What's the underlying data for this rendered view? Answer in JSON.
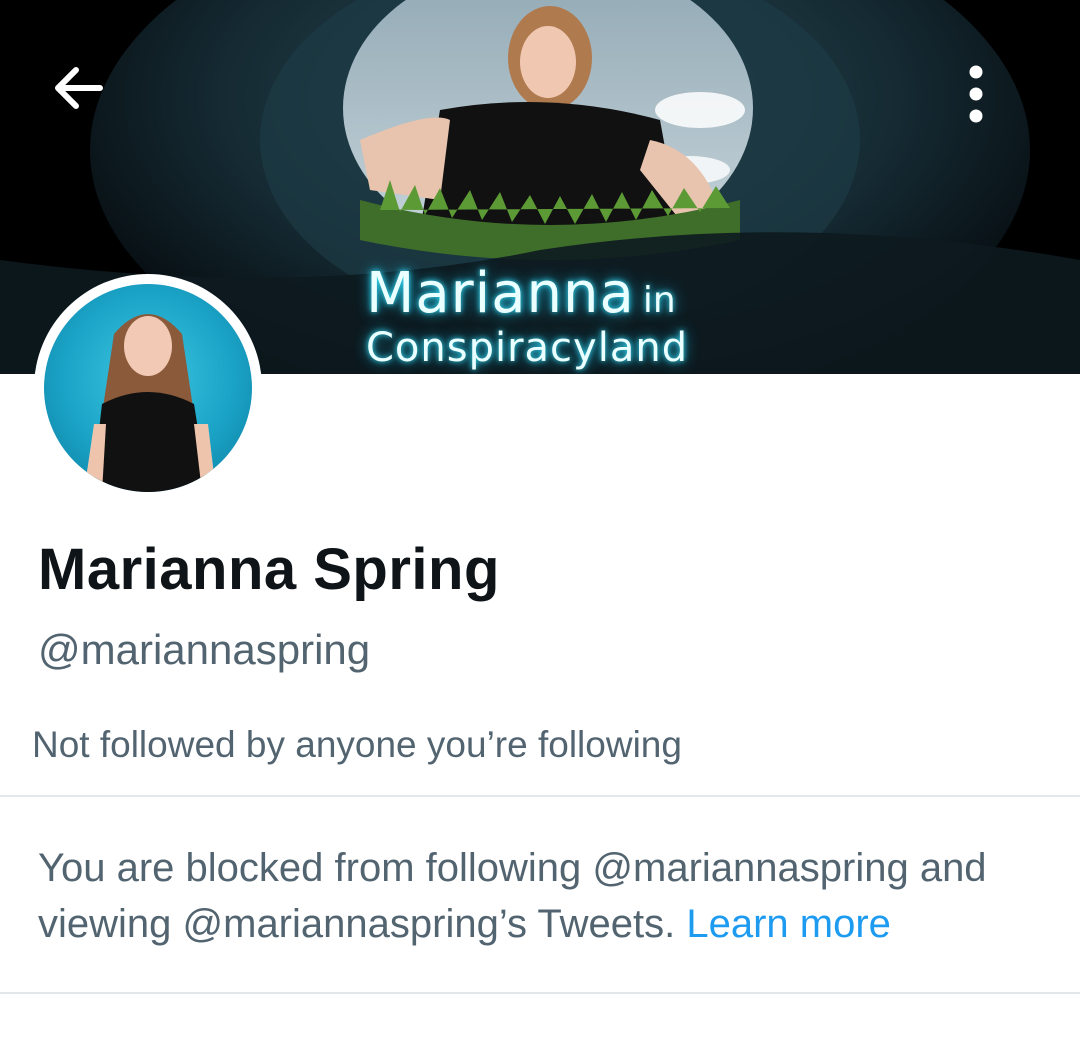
{
  "banner": {
    "title_main": "Marianna",
    "title_in": "in",
    "title_sub": "Conspiracyland"
  },
  "icons": {
    "back": "arrow-left-icon",
    "more": "more-vertical-icon"
  },
  "profile": {
    "name": "Marianna Spring",
    "handle": "@mariannaspring",
    "followers_note": "Not followed by anyone you’re following"
  },
  "blocked": {
    "message": "You are blocked from following @mariannaspring and viewing @mariannaspring’s Tweets.",
    "link_label": "Learn more"
  },
  "colors": {
    "link": "#1d9bf0",
    "secondary_text": "#536471",
    "primary_text": "#0f1419"
  }
}
